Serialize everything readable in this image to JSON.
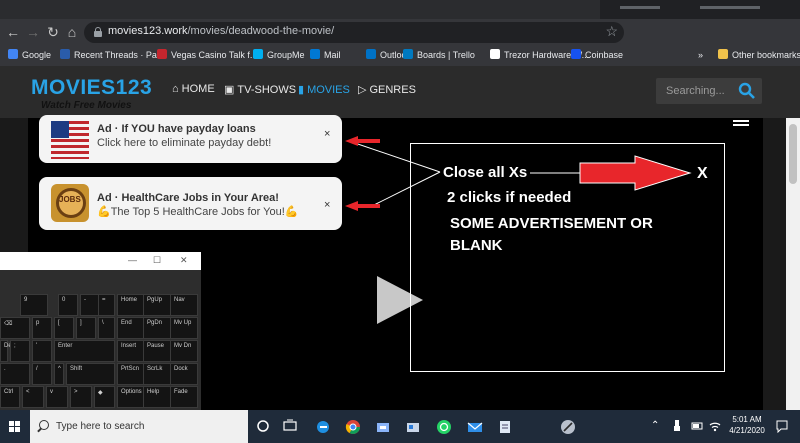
{
  "browser": {
    "address_host": "movies123.work",
    "address_path": "/movies/deadwood-the-movie/",
    "bookmarks": [
      {
        "label": "Google",
        "color": "#4285f4"
      },
      {
        "label": "Recent Threads · Pa...",
        "color": "#2a5caa"
      },
      {
        "label": "Vegas Casino Talk f...",
        "color": "#c4262e"
      },
      {
        "label": "GroupMe",
        "color": "#00aff0"
      },
      {
        "label": "Mail",
        "color": "#0078d4"
      },
      {
        "label": "Outlook",
        "color": "#0072c6"
      },
      {
        "label": "Boards | Trello",
        "color": "#0079bf"
      },
      {
        "label": "Trezor Hardware W...",
        "color": "#ffffff"
      },
      {
        "label": "Coinbase",
        "color": "#1652f0"
      },
      {
        "label": "»",
        "color": ""
      },
      {
        "label": "Other bookmarks",
        "color": "#f0c24b"
      }
    ]
  },
  "site": {
    "logo": "MOVIES123",
    "tagline": "Watch Free Movies",
    "nav": [
      {
        "label": "HOME",
        "icon": "home-icon",
        "active": false
      },
      {
        "label": "TV-SHOWS",
        "icon": "tv-icon",
        "active": false
      },
      {
        "label": "MOVIES",
        "icon": "movie-icon",
        "active": true
      },
      {
        "label": "GENRES",
        "icon": "genres-icon",
        "active": false
      }
    ],
    "search_placeholder": "Searching..."
  },
  "ads": [
    {
      "title": "Ad · If YOU have payday loans",
      "subtitle": "Click here to eliminate payday debt!",
      "close": "×",
      "image": "us-flag"
    },
    {
      "title": "Ad · HealthCare Jobs in Your Area!",
      "subtitle": "The Top 5 HealthCare Jobs for You!",
      "close": "×",
      "image": "jobs-magnifier",
      "image_label": "JOBS",
      "emoji": "💪"
    }
  ],
  "annotation": {
    "line1": "Close all Xs",
    "line2": "2 clicks if needed",
    "line3": "SOME ADVERTISEMENT  OR",
    "line4": "BLANK",
    "x_mark": "X",
    "accent": "#e8262b"
  },
  "keyboard": {
    "window_controls": [
      "—",
      "☐",
      "✕"
    ],
    "keys": [
      {
        "label": "9"
      },
      {
        "label": "0"
      },
      {
        "label": "-"
      },
      {
        "label": "="
      },
      {
        "label": "⌫"
      },
      {
        "label": "p"
      },
      {
        "label": "["
      },
      {
        "label": "]"
      },
      {
        "label": "\\"
      },
      {
        "label": "Del"
      },
      {
        "label": ";"
      },
      {
        "label": "'"
      },
      {
        "label": "Enter"
      },
      {
        "label": "."
      },
      {
        "label": "/"
      },
      {
        "label": "^"
      },
      {
        "label": "Shift"
      },
      {
        "label": "Ctrl"
      },
      {
        "label": "<"
      },
      {
        "label": "v"
      },
      {
        "label": ">"
      },
      {
        "label": "◆"
      },
      {
        "label": "Home"
      },
      {
        "label": "PgUp"
      },
      {
        "label": "Nav"
      },
      {
        "label": "End"
      },
      {
        "label": "PgDn"
      },
      {
        "label": "Mv Up"
      },
      {
        "label": "Insert"
      },
      {
        "label": "Pause"
      },
      {
        "label": "Mv Dn"
      },
      {
        "label": "PrtScn"
      },
      {
        "label": "ScrLk"
      },
      {
        "label": "Dock"
      },
      {
        "label": "Options"
      },
      {
        "label": "Help"
      },
      {
        "label": "Fade"
      }
    ]
  },
  "taskbar": {
    "search_placeholder": "Type here to search",
    "time": "5:01 AM",
    "date": "4/21/2020"
  }
}
